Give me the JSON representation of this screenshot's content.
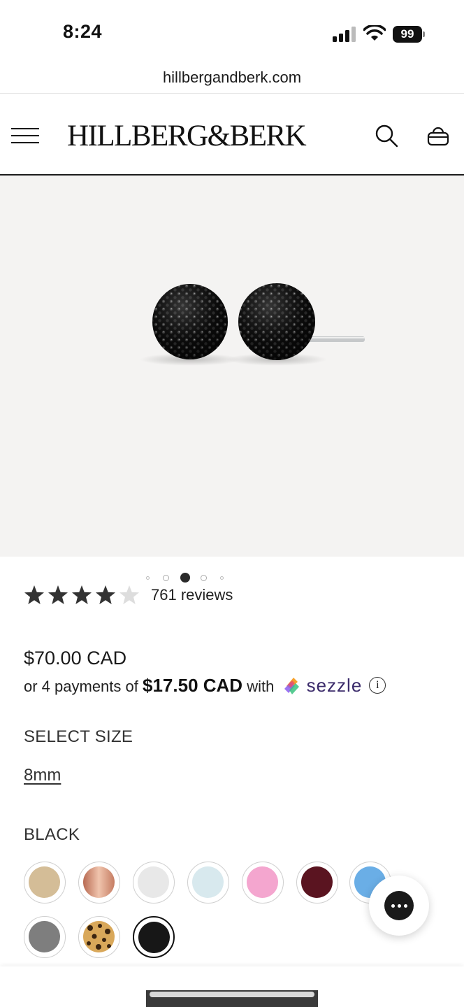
{
  "status_bar": {
    "time": "8:24",
    "battery": "99"
  },
  "browser": {
    "url": "hillbergandberk.com"
  },
  "header": {
    "logo": "HILLBERG&BERK"
  },
  "product": {
    "rating": 4.5,
    "review_count": "761 reviews",
    "carousel": {
      "total": 5,
      "active": 3
    },
    "price": "$70.00 CAD",
    "installments": {
      "prefix": "or 4 payments of",
      "amount": "$17.50 CAD",
      "suffix": "with",
      "provider": "sezzle",
      "info_symbol": "i"
    },
    "size": {
      "heading": "SELECT SIZE",
      "selected": "8mm"
    },
    "color": {
      "heading": "BLACK",
      "swatches": [
        {
          "color": "#d4bd97"
        },
        {
          "color": "#c9866a"
        },
        {
          "color": "#e8e8e8"
        },
        {
          "color": "#d8e9ee"
        },
        {
          "color": "#f4a6cf"
        },
        {
          "color": "#5a1420"
        },
        {
          "color": "#6aaee6"
        },
        {
          "color": "#7e7e7e"
        },
        {
          "color": "leopard"
        },
        {
          "color": "#171717",
          "selected": true
        }
      ]
    }
  }
}
